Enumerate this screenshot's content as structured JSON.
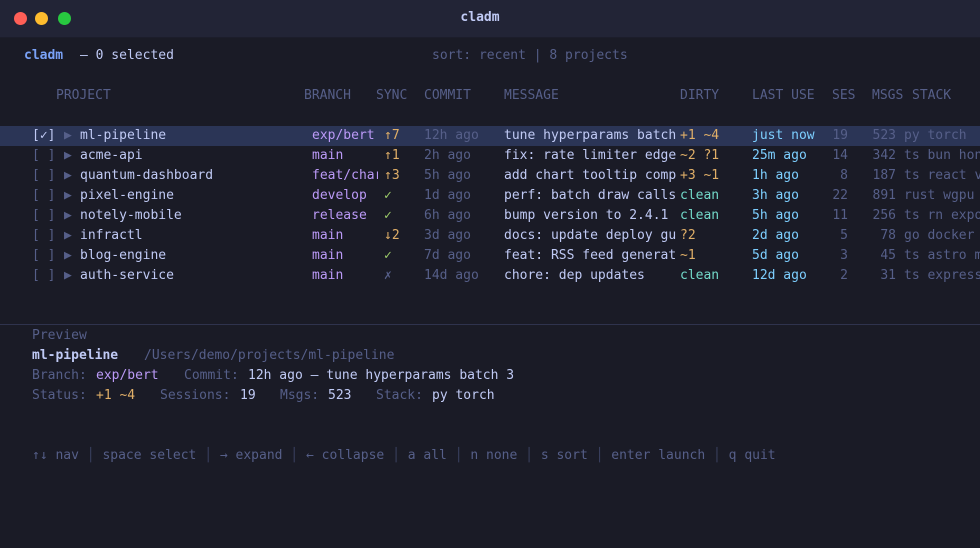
{
  "window": {
    "title": "cladm"
  },
  "header": {
    "app": "cladm",
    "selected": "— 0 selected",
    "status": "sort: recent | 8 projects"
  },
  "columns": [
    "PROJECT",
    "BRANCH",
    "SYNC",
    "COMMIT",
    "MESSAGE",
    "DIRTY",
    "LAST USE",
    "SES",
    "MSGS",
    "STACK"
  ],
  "rows": [
    {
      "check": "[✓]",
      "expand": "▶",
      "name": "ml-pipeline",
      "branch": "exp/bert",
      "sync": "↑7",
      "sync_color": "#e0af68",
      "commit": "12h ago",
      "message": "tune hyperparams batch",
      "dirty": "+1 ~4",
      "dirty_color": "#e0af68",
      "last": "just now",
      "ses": "19",
      "msgs": "523",
      "stack": "py torch",
      "selected": true
    },
    {
      "check": "[ ]",
      "expand": "▶",
      "name": "acme-api",
      "branch": "main",
      "sync": "↑1",
      "sync_color": "#e0af68",
      "commit": "2h ago",
      "message": "fix: rate limiter edge",
      "dirty": "~2 ?1",
      "dirty_color": "#e0af68",
      "last": "25m ago",
      "ses": "14",
      "msgs": "342",
      "stack": "ts bun hono"
    },
    {
      "check": "[ ]",
      "expand": "▶",
      "name": "quantum-dashboard",
      "branch": "feat/chart",
      "sync": "↑3",
      "sync_color": "#e0af68",
      "commit": "5h ago",
      "message": "add chart tooltip comp",
      "dirty": "+3 ~1",
      "dirty_color": "#e0af68",
      "last": "1h ago",
      "ses": "8",
      "msgs": "187",
      "stack": "ts react vite"
    },
    {
      "check": "[ ]",
      "expand": "▶",
      "name": "pixel-engine",
      "branch": "develop",
      "sync": "✓",
      "sync_color": "#9ece6a",
      "commit": "1d ago",
      "message": "perf: batch draw calls",
      "dirty": "clean",
      "dirty_color": "#73daca",
      "last": "3h ago",
      "ses": "22",
      "msgs": "891",
      "stack": "rust wgpu"
    },
    {
      "check": "[ ]",
      "expand": "▶",
      "name": "notely-mobile",
      "branch": "release",
      "sync": "✓",
      "sync_color": "#9ece6a",
      "commit": "6h ago",
      "message": "bump version to 2.4.1",
      "dirty": "clean",
      "dirty_color": "#73daca",
      "last": "5h ago",
      "ses": "11",
      "msgs": "256",
      "stack": "ts rn expo"
    },
    {
      "check": "[ ]",
      "expand": "▶",
      "name": "infractl",
      "branch": "main",
      "sync": "↓2",
      "sync_color": "#e0af68",
      "commit": "3d ago",
      "message": "docs: update deploy gu",
      "dirty": "?2",
      "dirty_color": "#e0af68",
      "last": "2d ago",
      "ses": "5",
      "msgs": "78",
      "stack": "go docker"
    },
    {
      "check": "[ ]",
      "expand": "▶",
      "name": "blog-engine",
      "branch": "main",
      "sync": "✓",
      "sync_color": "#9ece6a",
      "commit": "7d ago",
      "message": "feat: RSS feed generat",
      "dirty": "~1",
      "dirty_color": "#e0af68",
      "last": "5d ago",
      "ses": "3",
      "msgs": "45",
      "stack": "ts astro mdx"
    },
    {
      "check": "[ ]",
      "expand": "▶",
      "name": "auth-service",
      "branch": "main",
      "sync": "✗",
      "sync_color": "#565f89",
      "commit": "14d ago",
      "message": "chore: dep updates",
      "dirty": "clean",
      "dirty_color": "#73daca",
      "last": "12d ago",
      "ses": "2",
      "msgs": "31",
      "stack": "ts express"
    }
  ],
  "preview": {
    "heading": "Preview",
    "name": "ml-pipeline",
    "path": "/Users/demo/projects/ml-pipeline",
    "branch_label": "Branch:",
    "branch": "exp/bert",
    "commit_label": "Commit:",
    "commit": "12h ago — tune hyperparams batch 3",
    "status_label": "Status:",
    "status": "+1 ~4",
    "sessions_label": "Sessions:",
    "sessions": "19",
    "msgs_label": "Msgs:",
    "msgs": "523",
    "stack_label": "Stack:",
    "stack": "py torch"
  },
  "keys": [
    "↑↓ nav",
    "space select",
    "→ expand",
    "← collapse",
    "a all",
    "n none",
    "s sort",
    "enter launch",
    "q quit"
  ],
  "colors": {
    "accent": "#7aa2f7",
    "branch": "#bb9af7",
    "warn": "#e0af68",
    "ok": "#9ece6a",
    "clean": "#73daca",
    "selection": "#2b3556"
  }
}
